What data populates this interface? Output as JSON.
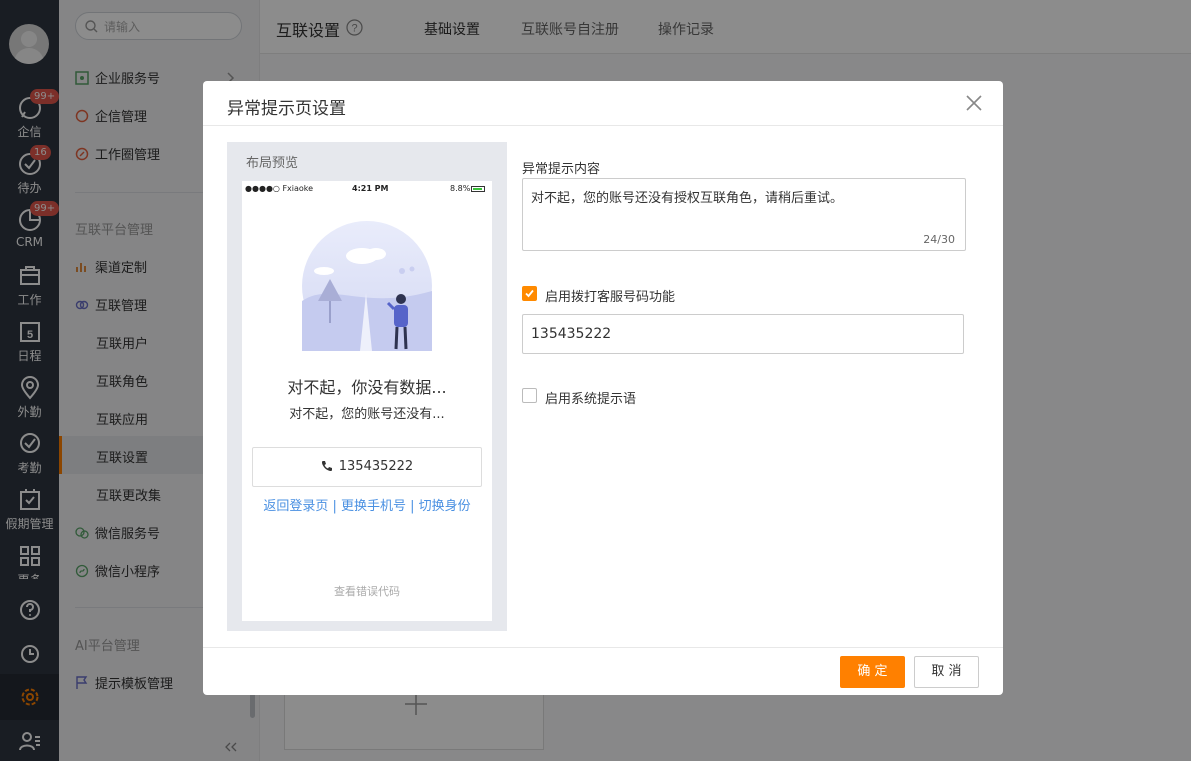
{
  "rail": {
    "items": [
      {
        "label": "企信",
        "badge": "99+"
      },
      {
        "label": "待办",
        "badge": "16"
      },
      {
        "label": "CRM",
        "badge": "99+"
      },
      {
        "label": "工作"
      },
      {
        "label": "日程",
        "day": "5"
      },
      {
        "label": "外勤"
      },
      {
        "label": "考勤"
      },
      {
        "label": "假期管理"
      },
      {
        "label": "更多"
      }
    ]
  },
  "sidebar": {
    "search_placeholder": "请输入",
    "items": [
      {
        "label": "企业服务号"
      },
      {
        "label": "企信管理"
      },
      {
        "label": "工作圈管理"
      }
    ],
    "section_platform": "互联平台管理",
    "platform_items": [
      {
        "label": "渠道定制"
      },
      {
        "label": "互联管理"
      }
    ],
    "sub_items": [
      {
        "label": "互联用户"
      },
      {
        "label": "互联角色"
      },
      {
        "label": "互联应用"
      },
      {
        "label": "互联设置"
      },
      {
        "label": "互联更改集"
      }
    ],
    "wechat_items": [
      {
        "label": "微信服务号"
      },
      {
        "label": "微信小程序"
      }
    ],
    "section_ai": "AI平台管理",
    "ai_items": [
      {
        "label": "提示模板管理"
      }
    ]
  },
  "header": {
    "title": "互联设置",
    "tabs": [
      {
        "label": "基础设置"
      },
      {
        "label": "互联账号自注册"
      },
      {
        "label": "操作记录"
      }
    ]
  },
  "modal": {
    "title": "异常提示页设置",
    "preview_label": "布局预览",
    "phone_status": {
      "carrier": "●●●●○ Fxiaoke",
      "time": "4:21 PM",
      "battery": "8.8%"
    },
    "preview_title": "对不起，你没有数据...",
    "preview_subtitle": "对不起，您的账号还没有...",
    "preview_phone": "135435222",
    "preview_links": "返回登录页 | 更换手机号 | 切换身份",
    "preview_code": "查看错误代码",
    "content_label": "异常提示内容",
    "content_value": "对不起，您的账号还没有授权互联角色，请稍后重试。",
    "content_count": "24/30",
    "call_checkbox_label": "启用拨打客服号码功能",
    "call_checked": true,
    "phone_value": "135435222",
    "system_checkbox_label": "启用系统提示语",
    "system_checked": false,
    "ok_label": "确 定",
    "cancel_label": "取 消"
  },
  "colors": {
    "accent": "#ff8000",
    "rail": "#2f3640",
    "link": "#4a90e2",
    "badge": "#e2574c"
  }
}
